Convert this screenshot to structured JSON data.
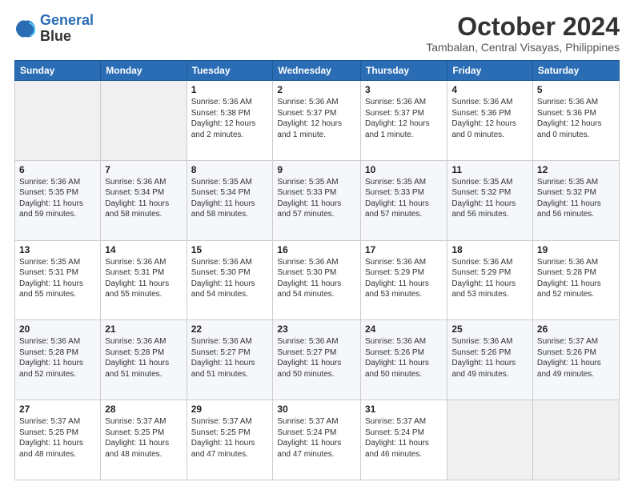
{
  "logo": {
    "line1": "General",
    "line2": "Blue"
  },
  "title": "October 2024",
  "location": "Tambalan, Central Visayas, Philippines",
  "headers": [
    "Sunday",
    "Monday",
    "Tuesday",
    "Wednesday",
    "Thursday",
    "Friday",
    "Saturday"
  ],
  "weeks": [
    [
      {
        "day": "",
        "info": ""
      },
      {
        "day": "",
        "info": ""
      },
      {
        "day": "1",
        "info": "Sunrise: 5:36 AM\nSunset: 5:38 PM\nDaylight: 12 hours\nand 2 minutes."
      },
      {
        "day": "2",
        "info": "Sunrise: 5:36 AM\nSunset: 5:37 PM\nDaylight: 12 hours\nand 1 minute."
      },
      {
        "day": "3",
        "info": "Sunrise: 5:36 AM\nSunset: 5:37 PM\nDaylight: 12 hours\nand 1 minute."
      },
      {
        "day": "4",
        "info": "Sunrise: 5:36 AM\nSunset: 5:36 PM\nDaylight: 12 hours\nand 0 minutes."
      },
      {
        "day": "5",
        "info": "Sunrise: 5:36 AM\nSunset: 5:36 PM\nDaylight: 12 hours\nand 0 minutes."
      }
    ],
    [
      {
        "day": "6",
        "info": "Sunrise: 5:36 AM\nSunset: 5:35 PM\nDaylight: 11 hours\nand 59 minutes."
      },
      {
        "day": "7",
        "info": "Sunrise: 5:36 AM\nSunset: 5:34 PM\nDaylight: 11 hours\nand 58 minutes."
      },
      {
        "day": "8",
        "info": "Sunrise: 5:35 AM\nSunset: 5:34 PM\nDaylight: 11 hours\nand 58 minutes."
      },
      {
        "day": "9",
        "info": "Sunrise: 5:35 AM\nSunset: 5:33 PM\nDaylight: 11 hours\nand 57 minutes."
      },
      {
        "day": "10",
        "info": "Sunrise: 5:35 AM\nSunset: 5:33 PM\nDaylight: 11 hours\nand 57 minutes."
      },
      {
        "day": "11",
        "info": "Sunrise: 5:35 AM\nSunset: 5:32 PM\nDaylight: 11 hours\nand 56 minutes."
      },
      {
        "day": "12",
        "info": "Sunrise: 5:35 AM\nSunset: 5:32 PM\nDaylight: 11 hours\nand 56 minutes."
      }
    ],
    [
      {
        "day": "13",
        "info": "Sunrise: 5:35 AM\nSunset: 5:31 PM\nDaylight: 11 hours\nand 55 minutes."
      },
      {
        "day": "14",
        "info": "Sunrise: 5:36 AM\nSunset: 5:31 PM\nDaylight: 11 hours\nand 55 minutes."
      },
      {
        "day": "15",
        "info": "Sunrise: 5:36 AM\nSunset: 5:30 PM\nDaylight: 11 hours\nand 54 minutes."
      },
      {
        "day": "16",
        "info": "Sunrise: 5:36 AM\nSunset: 5:30 PM\nDaylight: 11 hours\nand 54 minutes."
      },
      {
        "day": "17",
        "info": "Sunrise: 5:36 AM\nSunset: 5:29 PM\nDaylight: 11 hours\nand 53 minutes."
      },
      {
        "day": "18",
        "info": "Sunrise: 5:36 AM\nSunset: 5:29 PM\nDaylight: 11 hours\nand 53 minutes."
      },
      {
        "day": "19",
        "info": "Sunrise: 5:36 AM\nSunset: 5:28 PM\nDaylight: 11 hours\nand 52 minutes."
      }
    ],
    [
      {
        "day": "20",
        "info": "Sunrise: 5:36 AM\nSunset: 5:28 PM\nDaylight: 11 hours\nand 52 minutes."
      },
      {
        "day": "21",
        "info": "Sunrise: 5:36 AM\nSunset: 5:28 PM\nDaylight: 11 hours\nand 51 minutes."
      },
      {
        "day": "22",
        "info": "Sunrise: 5:36 AM\nSunset: 5:27 PM\nDaylight: 11 hours\nand 51 minutes."
      },
      {
        "day": "23",
        "info": "Sunrise: 5:36 AM\nSunset: 5:27 PM\nDaylight: 11 hours\nand 50 minutes."
      },
      {
        "day": "24",
        "info": "Sunrise: 5:36 AM\nSunset: 5:26 PM\nDaylight: 11 hours\nand 50 minutes."
      },
      {
        "day": "25",
        "info": "Sunrise: 5:36 AM\nSunset: 5:26 PM\nDaylight: 11 hours\nand 49 minutes."
      },
      {
        "day": "26",
        "info": "Sunrise: 5:37 AM\nSunset: 5:26 PM\nDaylight: 11 hours\nand 49 minutes."
      }
    ],
    [
      {
        "day": "27",
        "info": "Sunrise: 5:37 AM\nSunset: 5:25 PM\nDaylight: 11 hours\nand 48 minutes."
      },
      {
        "day": "28",
        "info": "Sunrise: 5:37 AM\nSunset: 5:25 PM\nDaylight: 11 hours\nand 48 minutes."
      },
      {
        "day": "29",
        "info": "Sunrise: 5:37 AM\nSunset: 5:25 PM\nDaylight: 11 hours\nand 47 minutes."
      },
      {
        "day": "30",
        "info": "Sunrise: 5:37 AM\nSunset: 5:24 PM\nDaylight: 11 hours\nand 47 minutes."
      },
      {
        "day": "31",
        "info": "Sunrise: 5:37 AM\nSunset: 5:24 PM\nDaylight: 11 hours\nand 46 minutes."
      },
      {
        "day": "",
        "info": ""
      },
      {
        "day": "",
        "info": ""
      }
    ]
  ]
}
